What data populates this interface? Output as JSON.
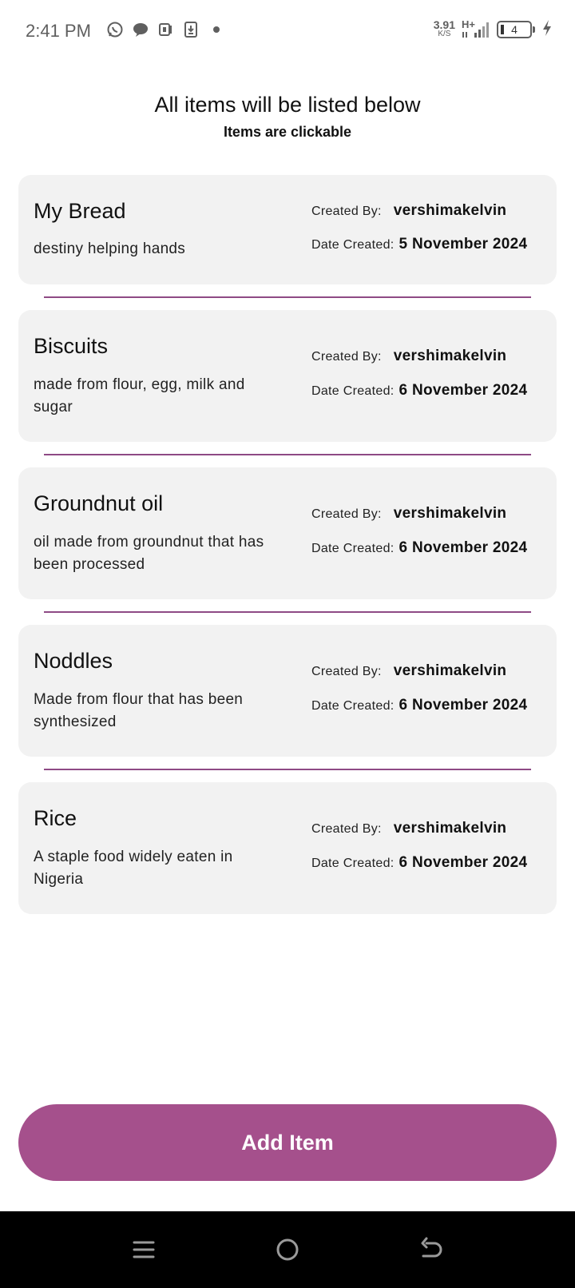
{
  "status_bar": {
    "time": "2:41 PM",
    "net_speed_value": "3.91",
    "net_speed_unit": "K/S",
    "network_type": "H+",
    "battery_level": "4",
    "icons": [
      "whatsapp-icon",
      "chat-bubble-icon",
      "nfc-icon",
      "download-icon",
      "dot-icon",
      "signal-icon",
      "battery-icon",
      "charging-icon"
    ]
  },
  "header": {
    "title": "All items will be listed below",
    "subtitle": "Items are clickable"
  },
  "labels": {
    "created_by": "Created By:",
    "date_created": "Date Created:"
  },
  "items": [
    {
      "title": "My Bread",
      "description": "destiny helping hands",
      "created_by": "vershimakelvin",
      "date_created": "5 November 2024"
    },
    {
      "title": "Biscuits",
      "description": "made from flour, egg, milk and sugar",
      "created_by": "vershimakelvin",
      "date_created": "6 November 2024"
    },
    {
      "title": "Groundnut oil",
      "description": "oil made from groundnut that has been processed",
      "created_by": "vershimakelvin",
      "date_created": "6 November 2024"
    },
    {
      "title": "Noddles",
      "description": "Made from flour that has been synthesized",
      "created_by": "vershimakelvin",
      "date_created": "6 November 2024"
    },
    {
      "title": "Rice",
      "description": "A staple food widely eaten in Nigeria",
      "created_by": "vershimakelvin",
      "date_created": "6 November 2024"
    }
  ],
  "add_button": {
    "label": "Add Item"
  },
  "colors": {
    "accent": "#a5508c",
    "divider": "#8e4a85",
    "card_bg": "#f2f2f2"
  }
}
